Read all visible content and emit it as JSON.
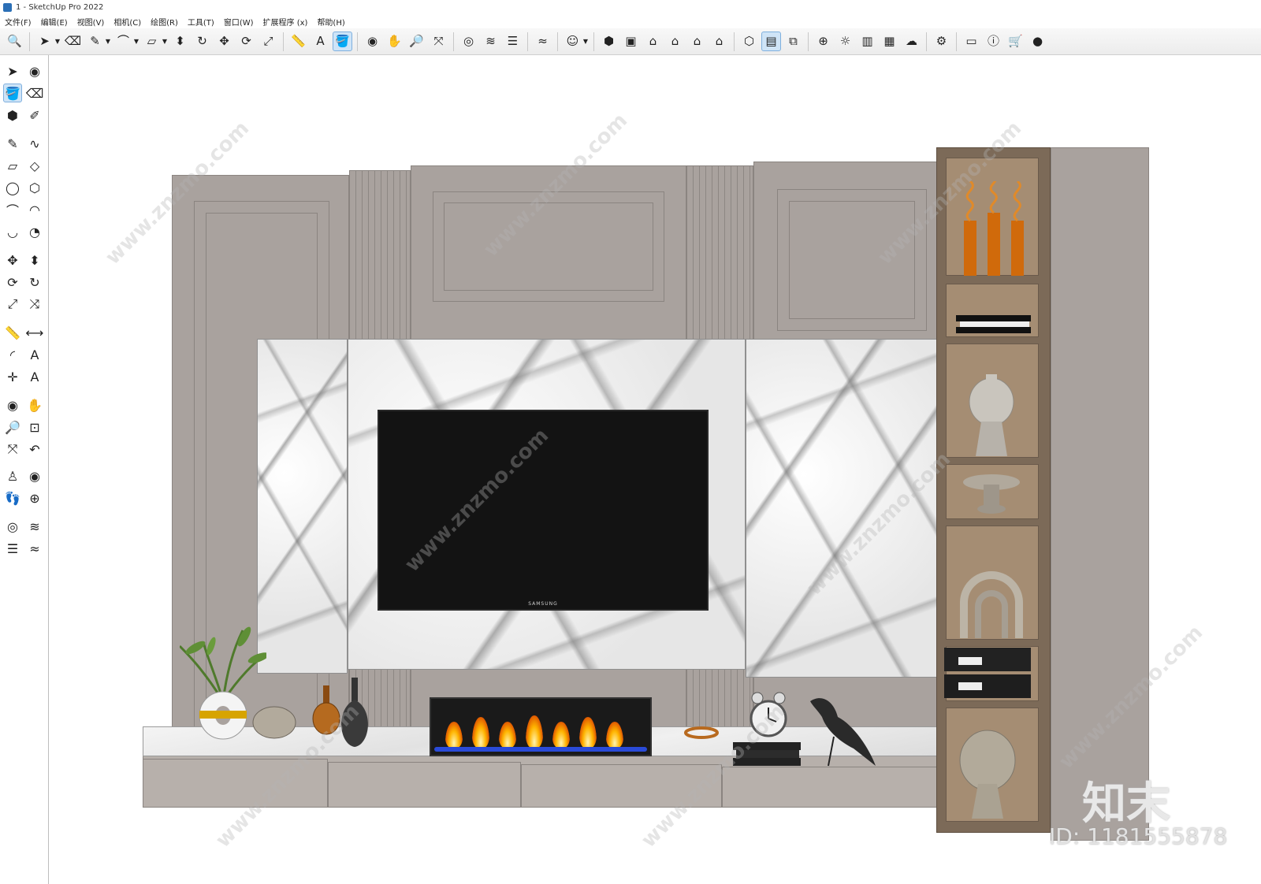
{
  "window": {
    "title": "1 - SketchUp Pro 2022"
  },
  "menu": [
    "文件(F)",
    "编辑(E)",
    "视图(V)",
    "相机(C)",
    "绘图(R)",
    "工具(T)",
    "窗口(W)",
    "扩展程序 (x)",
    "帮助(H)"
  ],
  "toolbar": {
    "icons": [
      {
        "name": "zoom-window-icon",
        "glyph": "🔍"
      },
      {
        "sep": true
      },
      {
        "name": "select-icon",
        "glyph": "➤",
        "dropdown": true
      },
      {
        "name": "eraser-icon",
        "glyph": "⌫"
      },
      {
        "name": "pencil-icon",
        "glyph": "✎",
        "dropdown": true
      },
      {
        "name": "arc-icon",
        "glyph": "⌒",
        "dropdown": true
      },
      {
        "name": "rectangle-icon",
        "glyph": "▱",
        "dropdown": true
      },
      {
        "name": "push-pull-icon",
        "glyph": "⬍"
      },
      {
        "name": "follow-me-icon",
        "glyph": "↻"
      },
      {
        "name": "move-icon",
        "glyph": "✥"
      },
      {
        "name": "rotate-icon",
        "glyph": "⟳"
      },
      {
        "name": "scale-icon",
        "glyph": "⤢"
      },
      {
        "sep": true
      },
      {
        "name": "tape-measure-icon",
        "glyph": "📏"
      },
      {
        "name": "text-icon",
        "glyph": "A"
      },
      {
        "name": "paint-bucket-icon",
        "glyph": "🪣",
        "active": true
      },
      {
        "sep": true
      },
      {
        "name": "orbit-icon",
        "glyph": "◉"
      },
      {
        "name": "pan-icon",
        "glyph": "✋"
      },
      {
        "name": "zoom-icon",
        "glyph": "🔎"
      },
      {
        "name": "zoom-extents-icon",
        "glyph": "⤧"
      },
      {
        "sep": true
      },
      {
        "name": "sandbox-contours-icon",
        "glyph": "◎"
      },
      {
        "name": "sandbox-scratch-icon",
        "glyph": "≋"
      },
      {
        "name": "sandbox-smoove-icon",
        "glyph": "☰"
      },
      {
        "sep": true
      },
      {
        "name": "sandbox-drape-icon",
        "glyph": "≈"
      },
      {
        "sep": true
      },
      {
        "name": "account-icon",
        "glyph": "☺",
        "dropdown": true
      },
      {
        "sep": true
      },
      {
        "name": "iso-view-icon",
        "glyph": "⬢"
      },
      {
        "name": "top-view-icon",
        "glyph": "▣"
      },
      {
        "name": "front-view-icon",
        "glyph": "⌂"
      },
      {
        "name": "right-view-icon",
        "glyph": "⌂"
      },
      {
        "name": "back-view-icon",
        "glyph": "⌂"
      },
      {
        "name": "left-view-icon",
        "glyph": "⌂"
      },
      {
        "sep": true
      },
      {
        "name": "3d-warehouse-icon",
        "glyph": "⬡"
      },
      {
        "name": "section-plane-icon",
        "glyph": "▤",
        "active": true
      },
      {
        "name": "components-icon",
        "glyph": "⧉"
      },
      {
        "sep": true
      },
      {
        "name": "add-location-icon",
        "glyph": "⊕"
      },
      {
        "name": "shadows-icon",
        "glyph": "☼"
      },
      {
        "name": "layers-icon",
        "glyph": "▥"
      },
      {
        "name": "texture-icon",
        "glyph": "▦"
      },
      {
        "name": "cloud-icon",
        "glyph": "☁"
      },
      {
        "sep": true
      },
      {
        "name": "extensions-icon",
        "glyph": "⚙"
      },
      {
        "sep": true
      },
      {
        "name": "message-icon",
        "glyph": "▭"
      },
      {
        "name": "info-icon",
        "glyph": "ⓘ"
      },
      {
        "name": "cart-icon",
        "glyph": "🛒"
      },
      {
        "name": "profile-icon",
        "glyph": "●"
      }
    ]
  },
  "left_tools": [
    {
      "name": "select-tool-icon",
      "glyph": "➤"
    },
    {
      "name": "orbit-tool-icon",
      "glyph": "◉"
    },
    {
      "name": "paint-tool-icon",
      "glyph": "🪣",
      "active": true
    },
    {
      "name": "eraser-tool-icon",
      "glyph": "⌫"
    },
    {
      "name": "component-tool-icon",
      "glyph": "⬢"
    },
    {
      "name": "tag-tool-icon",
      "glyph": "✐"
    },
    {
      "name": "line-tool-icon",
      "glyph": "✎"
    },
    {
      "name": "freehand-tool-icon",
      "glyph": "∿"
    },
    {
      "name": "rect-tool-icon",
      "glyph": "▱"
    },
    {
      "name": "rotated-rect-tool-icon",
      "glyph": "◇"
    },
    {
      "name": "circle-tool-icon",
      "glyph": "◯"
    },
    {
      "name": "polygon-tool-icon",
      "glyph": "⬡"
    },
    {
      "name": "arc-tool-icon",
      "glyph": "⌒"
    },
    {
      "name": "arc2-tool-icon",
      "glyph": "◠"
    },
    {
      "name": "arc3-tool-icon",
      "glyph": "◡"
    },
    {
      "name": "pie-tool-icon",
      "glyph": "◔"
    },
    {
      "name": "move-tool-icon",
      "glyph": "✥"
    },
    {
      "name": "pushpull-tool-icon",
      "glyph": "⬍"
    },
    {
      "name": "rotate-tool-icon",
      "glyph": "⟳"
    },
    {
      "name": "followme-tool-icon",
      "glyph": "↻"
    },
    {
      "name": "scale-tool-icon",
      "glyph": "⤢"
    },
    {
      "name": "offset-tool-icon",
      "glyph": "⤨"
    },
    {
      "name": "tape-tool-icon",
      "glyph": "📏"
    },
    {
      "name": "dimension-tool-icon",
      "glyph": "⟷"
    },
    {
      "name": "protractor-tool-icon",
      "glyph": "◜"
    },
    {
      "name": "text-tool-icon",
      "glyph": "A"
    },
    {
      "name": "axes-tool-icon",
      "glyph": "✛"
    },
    {
      "name": "3dtext-tool-icon",
      "glyph": "A"
    },
    {
      "name": "orbit2-tool-icon",
      "glyph": "◉"
    },
    {
      "name": "pan-tool-icon",
      "glyph": "✋"
    },
    {
      "name": "zoom-tool-icon",
      "glyph": "🔎"
    },
    {
      "name": "zoom-window-tool-icon",
      "glyph": "⊡"
    },
    {
      "name": "zoom-extents-tool-icon",
      "glyph": "⤧"
    },
    {
      "name": "prev-view-tool-icon",
      "glyph": "↶"
    },
    {
      "name": "position-camera-tool-icon",
      "glyph": "♙"
    },
    {
      "name": "look-around-tool-icon",
      "glyph": "◉"
    },
    {
      "name": "walk-tool-icon",
      "glyph": "👣"
    },
    {
      "name": "section-tool-icon",
      "glyph": "⊕"
    },
    {
      "name": "contours-tool-icon",
      "glyph": "◎"
    },
    {
      "name": "scratch-tool-icon",
      "glyph": "≋"
    },
    {
      "name": "smoove-tool-icon",
      "glyph": "☰"
    },
    {
      "name": "drape-tool-icon",
      "glyph": "≈"
    }
  ],
  "model": {
    "tv_brand": "SAMSUNG"
  },
  "watermark": {
    "site": "www.znzmo.com",
    "brand": "知末",
    "id_label": "ID: 1181555878"
  },
  "colors": {
    "panel": "#a9a29e",
    "wood_shelf": "#7c6a58",
    "tv_screen": "#131313",
    "active_tool": "#cfe4f7"
  }
}
